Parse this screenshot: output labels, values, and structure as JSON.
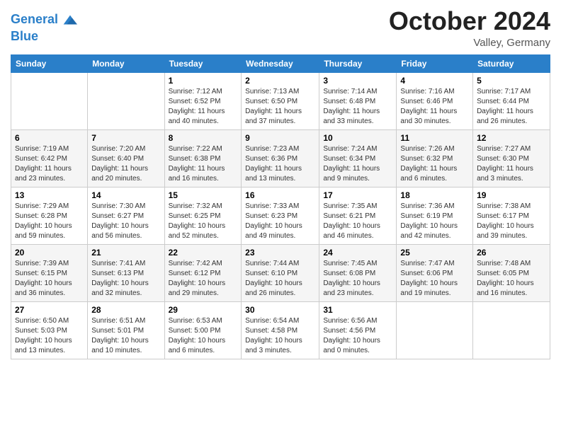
{
  "header": {
    "logo_line1": "General",
    "logo_line2": "Blue",
    "month": "October 2024",
    "location": "Valley, Germany"
  },
  "weekdays": [
    "Sunday",
    "Monday",
    "Tuesday",
    "Wednesday",
    "Thursday",
    "Friday",
    "Saturday"
  ],
  "weeks": [
    [
      {
        "day": "",
        "sunrise": "",
        "sunset": "",
        "daylight": ""
      },
      {
        "day": "",
        "sunrise": "",
        "sunset": "",
        "daylight": ""
      },
      {
        "day": "1",
        "sunrise": "Sunrise: 7:12 AM",
        "sunset": "Sunset: 6:52 PM",
        "daylight": "Daylight: 11 hours and 40 minutes."
      },
      {
        "day": "2",
        "sunrise": "Sunrise: 7:13 AM",
        "sunset": "Sunset: 6:50 PM",
        "daylight": "Daylight: 11 hours and 37 minutes."
      },
      {
        "day": "3",
        "sunrise": "Sunrise: 7:14 AM",
        "sunset": "Sunset: 6:48 PM",
        "daylight": "Daylight: 11 hours and 33 minutes."
      },
      {
        "day": "4",
        "sunrise": "Sunrise: 7:16 AM",
        "sunset": "Sunset: 6:46 PM",
        "daylight": "Daylight: 11 hours and 30 minutes."
      },
      {
        "day": "5",
        "sunrise": "Sunrise: 7:17 AM",
        "sunset": "Sunset: 6:44 PM",
        "daylight": "Daylight: 11 hours and 26 minutes."
      }
    ],
    [
      {
        "day": "6",
        "sunrise": "Sunrise: 7:19 AM",
        "sunset": "Sunset: 6:42 PM",
        "daylight": "Daylight: 11 hours and 23 minutes."
      },
      {
        "day": "7",
        "sunrise": "Sunrise: 7:20 AM",
        "sunset": "Sunset: 6:40 PM",
        "daylight": "Daylight: 11 hours and 20 minutes."
      },
      {
        "day": "8",
        "sunrise": "Sunrise: 7:22 AM",
        "sunset": "Sunset: 6:38 PM",
        "daylight": "Daylight: 11 hours and 16 minutes."
      },
      {
        "day": "9",
        "sunrise": "Sunrise: 7:23 AM",
        "sunset": "Sunset: 6:36 PM",
        "daylight": "Daylight: 11 hours and 13 minutes."
      },
      {
        "day": "10",
        "sunrise": "Sunrise: 7:24 AM",
        "sunset": "Sunset: 6:34 PM",
        "daylight": "Daylight: 11 hours and 9 minutes."
      },
      {
        "day": "11",
        "sunrise": "Sunrise: 7:26 AM",
        "sunset": "Sunset: 6:32 PM",
        "daylight": "Daylight: 11 hours and 6 minutes."
      },
      {
        "day": "12",
        "sunrise": "Sunrise: 7:27 AM",
        "sunset": "Sunset: 6:30 PM",
        "daylight": "Daylight: 11 hours and 3 minutes."
      }
    ],
    [
      {
        "day": "13",
        "sunrise": "Sunrise: 7:29 AM",
        "sunset": "Sunset: 6:28 PM",
        "daylight": "Daylight: 10 hours and 59 minutes."
      },
      {
        "day": "14",
        "sunrise": "Sunrise: 7:30 AM",
        "sunset": "Sunset: 6:27 PM",
        "daylight": "Daylight: 10 hours and 56 minutes."
      },
      {
        "day": "15",
        "sunrise": "Sunrise: 7:32 AM",
        "sunset": "Sunset: 6:25 PM",
        "daylight": "Daylight: 10 hours and 52 minutes."
      },
      {
        "day": "16",
        "sunrise": "Sunrise: 7:33 AM",
        "sunset": "Sunset: 6:23 PM",
        "daylight": "Daylight: 10 hours and 49 minutes."
      },
      {
        "day": "17",
        "sunrise": "Sunrise: 7:35 AM",
        "sunset": "Sunset: 6:21 PM",
        "daylight": "Daylight: 10 hours and 46 minutes."
      },
      {
        "day": "18",
        "sunrise": "Sunrise: 7:36 AM",
        "sunset": "Sunset: 6:19 PM",
        "daylight": "Daylight: 10 hours and 42 minutes."
      },
      {
        "day": "19",
        "sunrise": "Sunrise: 7:38 AM",
        "sunset": "Sunset: 6:17 PM",
        "daylight": "Daylight: 10 hours and 39 minutes."
      }
    ],
    [
      {
        "day": "20",
        "sunrise": "Sunrise: 7:39 AM",
        "sunset": "Sunset: 6:15 PM",
        "daylight": "Daylight: 10 hours and 36 minutes."
      },
      {
        "day": "21",
        "sunrise": "Sunrise: 7:41 AM",
        "sunset": "Sunset: 6:13 PM",
        "daylight": "Daylight: 10 hours and 32 minutes."
      },
      {
        "day": "22",
        "sunrise": "Sunrise: 7:42 AM",
        "sunset": "Sunset: 6:12 PM",
        "daylight": "Daylight: 10 hours and 29 minutes."
      },
      {
        "day": "23",
        "sunrise": "Sunrise: 7:44 AM",
        "sunset": "Sunset: 6:10 PM",
        "daylight": "Daylight: 10 hours and 26 minutes."
      },
      {
        "day": "24",
        "sunrise": "Sunrise: 7:45 AM",
        "sunset": "Sunset: 6:08 PM",
        "daylight": "Daylight: 10 hours and 23 minutes."
      },
      {
        "day": "25",
        "sunrise": "Sunrise: 7:47 AM",
        "sunset": "Sunset: 6:06 PM",
        "daylight": "Daylight: 10 hours and 19 minutes."
      },
      {
        "day": "26",
        "sunrise": "Sunrise: 7:48 AM",
        "sunset": "Sunset: 6:05 PM",
        "daylight": "Daylight: 10 hours and 16 minutes."
      }
    ],
    [
      {
        "day": "27",
        "sunrise": "Sunrise: 6:50 AM",
        "sunset": "Sunset: 5:03 PM",
        "daylight": "Daylight: 10 hours and 13 minutes."
      },
      {
        "day": "28",
        "sunrise": "Sunrise: 6:51 AM",
        "sunset": "Sunset: 5:01 PM",
        "daylight": "Daylight: 10 hours and 10 minutes."
      },
      {
        "day": "29",
        "sunrise": "Sunrise: 6:53 AM",
        "sunset": "Sunset: 5:00 PM",
        "daylight": "Daylight: 10 hours and 6 minutes."
      },
      {
        "day": "30",
        "sunrise": "Sunrise: 6:54 AM",
        "sunset": "Sunset: 4:58 PM",
        "daylight": "Daylight: 10 hours and 3 minutes."
      },
      {
        "day": "31",
        "sunrise": "Sunrise: 6:56 AM",
        "sunset": "Sunset: 4:56 PM",
        "daylight": "Daylight: 10 hours and 0 minutes."
      },
      {
        "day": "",
        "sunrise": "",
        "sunset": "",
        "daylight": ""
      },
      {
        "day": "",
        "sunrise": "",
        "sunset": "",
        "daylight": ""
      }
    ]
  ]
}
